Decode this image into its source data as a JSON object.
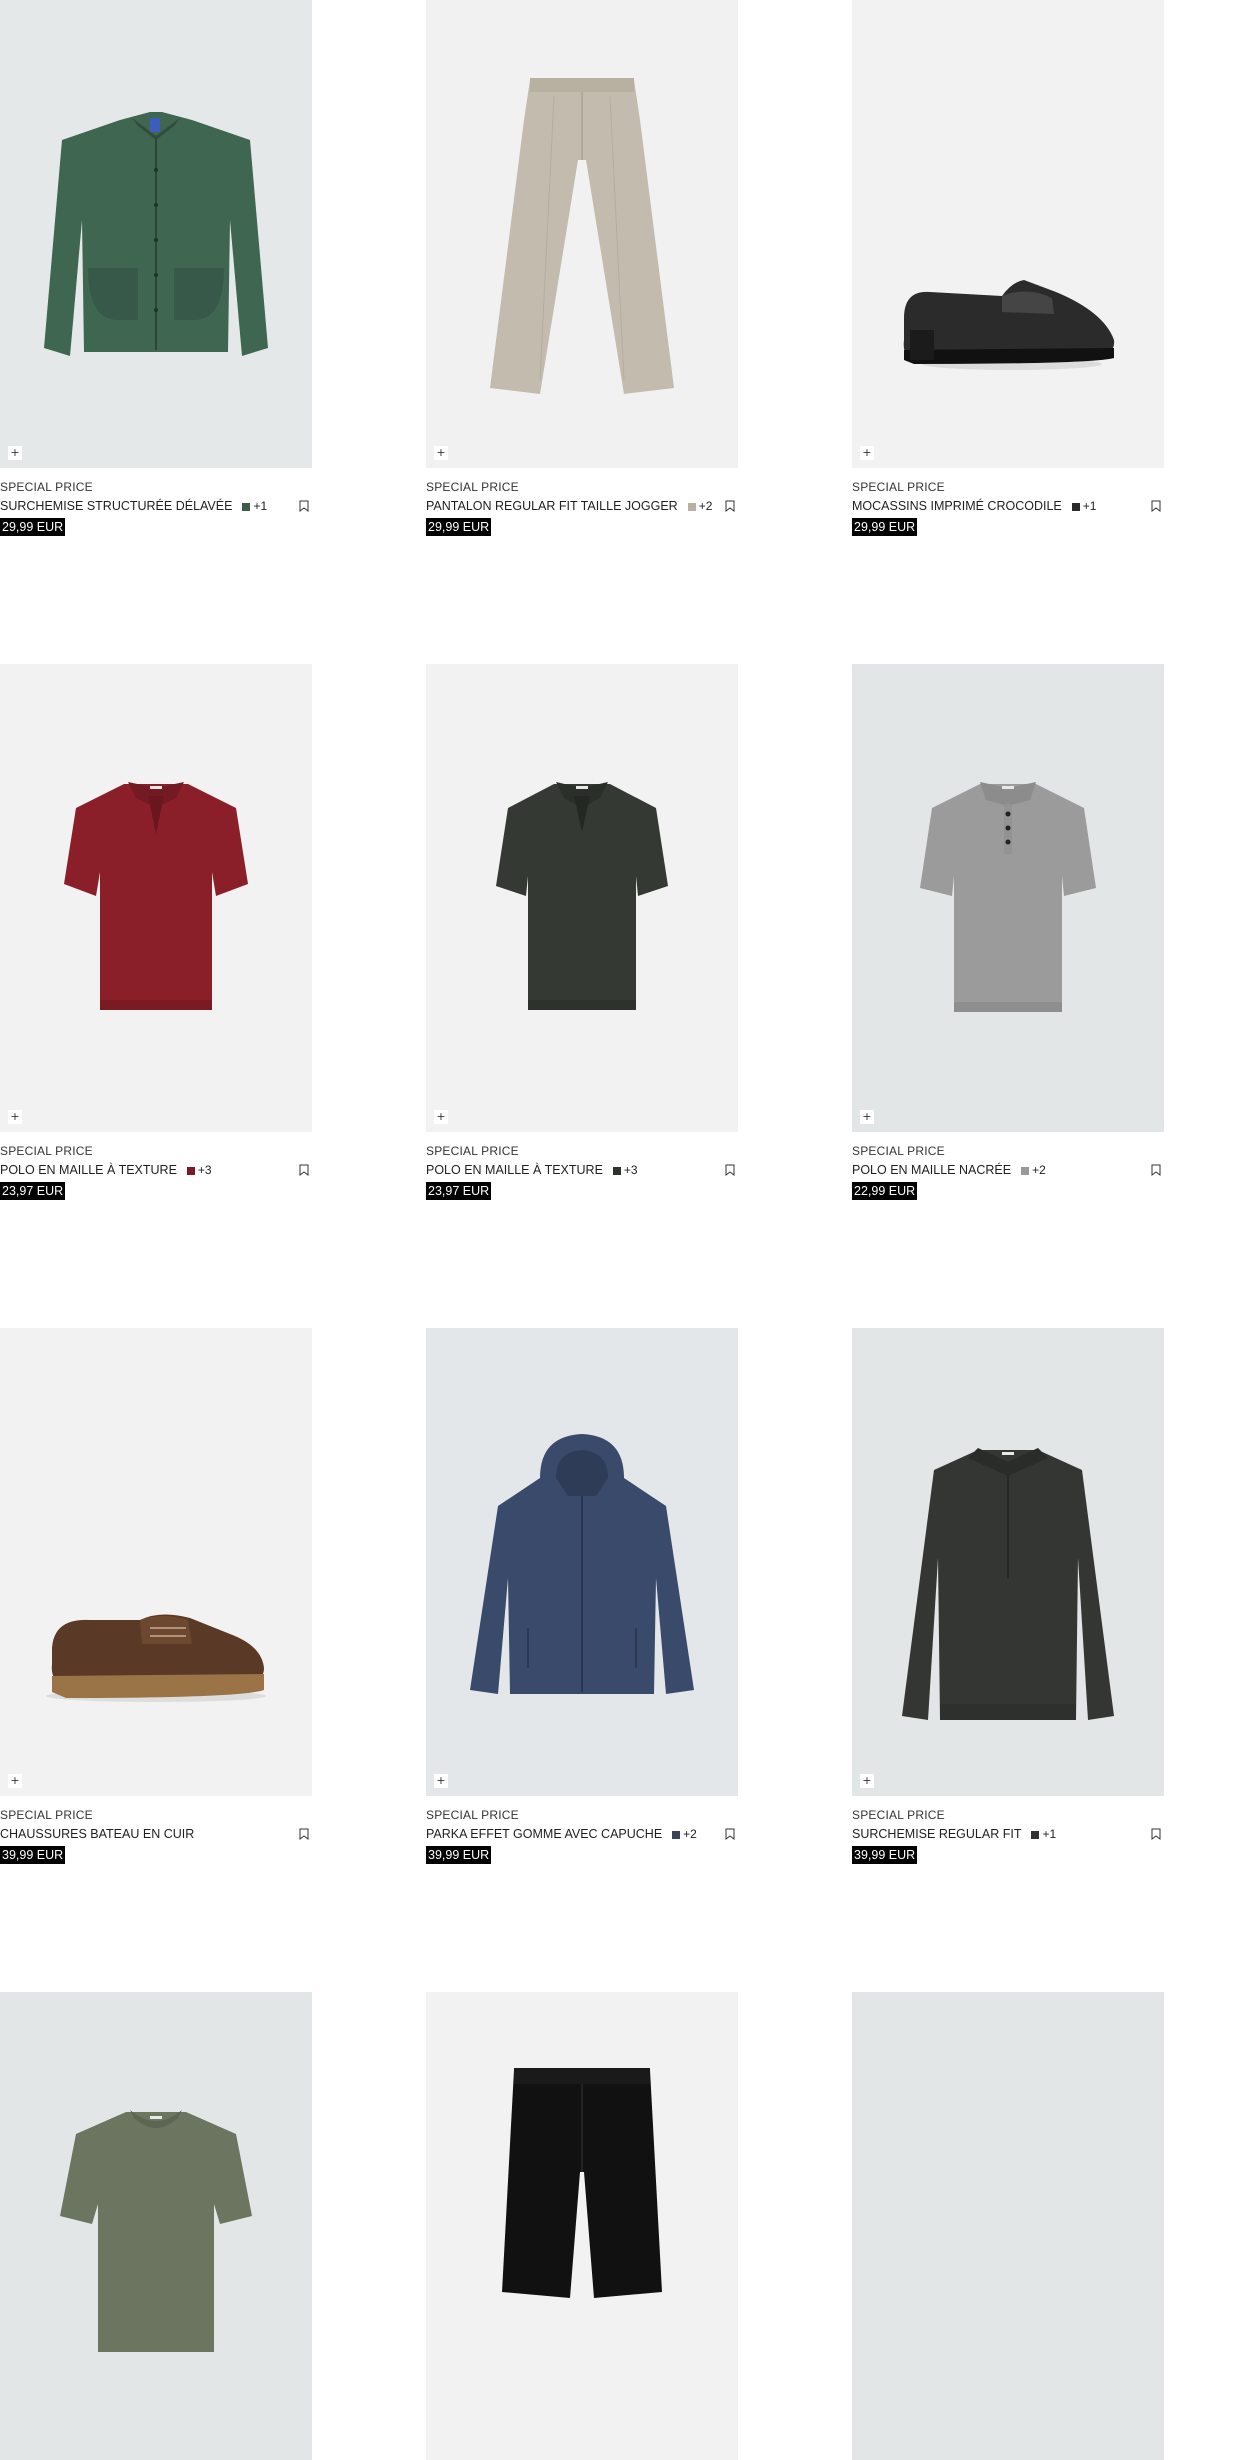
{
  "colors": {
    "price_bg": "#000000",
    "price_text": "#ffffff",
    "text": "#1f1f1f"
  },
  "products": [
    {
      "badge": "SPECIAL PRICE",
      "name": "SURCHEMISE STRUCTURÉE DÉLAVÉE",
      "swatch": "#3d5a4a",
      "more": "+1",
      "price": "29,99 EUR",
      "bg": "#e5e8e8",
      "icon": "green-overshirt-image"
    },
    {
      "badge": "SPECIAL PRICE",
      "name": "PANTALON REGULAR FIT TAILLE JOGGER",
      "swatch": "#b9b0a0",
      "more": "+2",
      "price": "29,99 EUR",
      "bg": "#f1f1f1",
      "icon": "beige-trousers-image"
    },
    {
      "badge": "SPECIAL PRICE",
      "name": "MOCASSINS IMPRIMÉ CROCODILE",
      "swatch": "#2a2a2a",
      "more": "+1",
      "price": "29,99 EUR",
      "bg": "#f2f2f2",
      "icon": "black-loafer-image"
    },
    {
      "badge": "SPECIAL PRICE",
      "name": "POLO EN MAILLE À TEXTURE",
      "swatch": "#7a1a22",
      "more": "+3",
      "price": "23,97 EUR",
      "bg": "#f2f2f2",
      "icon": "red-polo-image"
    },
    {
      "badge": "SPECIAL PRICE",
      "name": "POLO EN MAILLE À TEXTURE",
      "swatch": "#2e322d",
      "more": "+3",
      "price": "23,97 EUR",
      "bg": "#f2f2f2",
      "icon": "dark-green-polo-image"
    },
    {
      "badge": "SPECIAL PRICE",
      "name": "POLO EN MAILLE NACRÉE",
      "swatch": "#9a9a9a",
      "more": "+2",
      "price": "22,99 EUR",
      "bg": "#e3e6e7",
      "icon": "grey-polo-image"
    },
    {
      "badge": "SPECIAL PRICE",
      "name": "CHAUSSURES BATEAU EN CUIR",
      "swatch": "",
      "more": "",
      "price": "39,99 EUR",
      "bg": "#f2f2f2",
      "icon": "brown-boat-shoe-image"
    },
    {
      "badge": "SPECIAL PRICE",
      "name": "PARKA EFFET GOMME AVEC CAPUCHE",
      "swatch": "#3a4456",
      "more": "+2",
      "price": "39,99 EUR",
      "bg": "#e4e7e9",
      "icon": "navy-parka-image"
    },
    {
      "badge": "SPECIAL PRICE",
      "name": "SURCHEMISE REGULAR FIT",
      "swatch": "#333",
      "more": "+1",
      "price": "39,99 EUR",
      "bg": "#e3e6e7",
      "icon": "black-overshirt-image"
    },
    {
      "badge": "",
      "name": "",
      "swatch": "",
      "more": "",
      "price": "",
      "bg": "#e3e6e7",
      "icon": "olive-tshirt-image"
    },
    {
      "badge": "",
      "name": "",
      "swatch": "",
      "more": "",
      "price": "",
      "bg": "#f2f2f2",
      "icon": "black-shorts-image"
    },
    {
      "badge": "",
      "name": "",
      "swatch": "",
      "more": "",
      "price": "",
      "bg": "#e3e6e7",
      "icon": "empty-product-image"
    }
  ],
  "ui": {
    "quick_add": "+",
    "plus_icon": "plus-icon",
    "bookmark_icon": "bookmark-icon"
  }
}
